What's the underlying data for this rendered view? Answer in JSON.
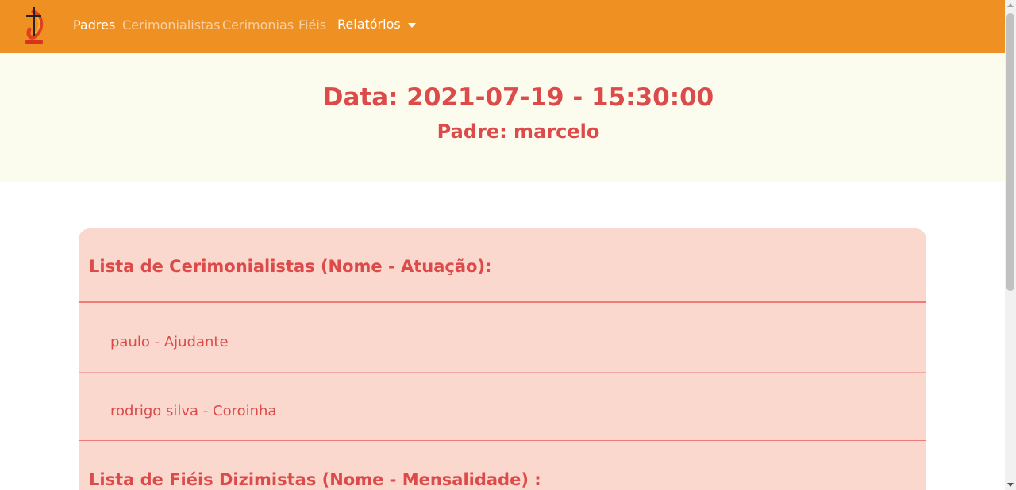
{
  "colors": {
    "navbar_bg": "#ef9022",
    "jumbotron_bg": "#fbfbee",
    "card_bg": "#fad8ce",
    "accent_text": "#dc4a4a",
    "divider": "#ef7b7b"
  },
  "navbar": {
    "logo_icon": "cross-logo-icon",
    "links": [
      {
        "label": "Padres",
        "active": true
      },
      {
        "label": "Cerimonialistas",
        "active": false
      },
      {
        "label": "Cerimonias",
        "active": false
      },
      {
        "label": "Fiéis",
        "active": false
      }
    ],
    "dropdown": {
      "label": "Relatórios",
      "icon": "caret-down-icon"
    }
  },
  "jumbotron": {
    "date_line": "Data: 2021-07-19 - 15:30:00",
    "padre_line": "Padre: marcelo"
  },
  "card": {
    "cerimonialistas_header": "Lista de Cerimonialistas (Nome - Atuação):",
    "cerimonialistas": [
      "paulo - Ajudante",
      "rodrigo silva - Coroinha"
    ],
    "fieis_header": "Lista de Fiéis Dizimistas (Nome - Mensalidade) :"
  }
}
